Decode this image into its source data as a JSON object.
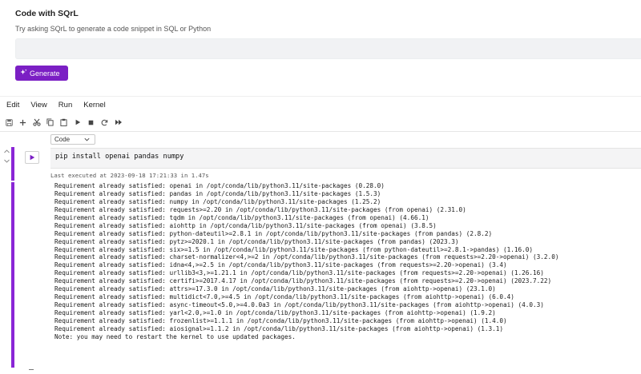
{
  "sqrl": {
    "title": "Code with SQrL",
    "hint": "Try asking SQrL to generate a code snippet in SQL or Python",
    "input_value": "",
    "generate_label": "Generate"
  },
  "menu": [
    "Edit",
    "View",
    "Run",
    "Kernel"
  ],
  "toolbar": [
    "save-icon",
    "add-icon",
    "cut-icon",
    "copy-icon",
    "paste-icon",
    "run-icon",
    "stop-icon",
    "restart-icon",
    "fast-forward-icon"
  ],
  "cell": {
    "type": "Code",
    "code": "pip install openai pandas numpy",
    "exec_meta": "Last executed at 2023-09-18 17:21:33 in 1.47s"
  },
  "output_lines": [
    "Requirement already satisfied: openai in /opt/conda/lib/python3.11/site-packages (0.28.0)",
    "Requirement already satisfied: pandas in /opt/conda/lib/python3.11/site-packages (1.5.3)",
    "Requirement already satisfied: numpy in /opt/conda/lib/python3.11/site-packages (1.25.2)",
    "Requirement already satisfied: requests>=2.20 in /opt/conda/lib/python3.11/site-packages (from openai) (2.31.0)",
    "Requirement already satisfied: tqdm in /opt/conda/lib/python3.11/site-packages (from openai) (4.66.1)",
    "Requirement already satisfied: aiohttp in /opt/conda/lib/python3.11/site-packages (from openai) (3.8.5)",
    "Requirement already satisfied: python-dateutil>=2.8.1 in /opt/conda/lib/python3.11/site-packages (from pandas) (2.8.2)",
    "Requirement already satisfied: pytz>=2020.1 in /opt/conda/lib/python3.11/site-packages (from pandas) (2023.3)",
    "Requirement already satisfied: six>=1.5 in /opt/conda/lib/python3.11/site-packages (from python-dateutil>=2.8.1->pandas) (1.16.0)",
    "Requirement already satisfied: charset-normalizer<4,>=2 in /opt/conda/lib/python3.11/site-packages (from requests>=2.20->openai) (3.2.0)",
    "Requirement already satisfied: idna<4,>=2.5 in /opt/conda/lib/python3.11/site-packages (from requests>=2.20->openai) (3.4)",
    "Requirement already satisfied: urllib3<3,>=1.21.1 in /opt/conda/lib/python3.11/site-packages (from requests>=2.20->openai) (1.26.16)",
    "Requirement already satisfied: certifi>=2017.4.17 in /opt/conda/lib/python3.11/site-packages (from requests>=2.20->openai) (2023.7.22)",
    "Requirement already satisfied: attrs>=17.3.0 in /opt/conda/lib/python3.11/site-packages (from aiohttp->openai) (23.1.0)",
    "Requirement already satisfied: multidict<7.0,>=4.5 in /opt/conda/lib/python3.11/site-packages (from aiohttp->openai) (6.0.4)",
    "Requirement already satisfied: async-timeout<5.0,>=4.0.0a3 in /opt/conda/lib/python3.11/site-packages (from aiohttp->openai) (4.0.3)",
    "Requirement already satisfied: yarl<2.0,>=1.0 in /opt/conda/lib/python3.11/site-packages (from aiohttp->openai) (1.9.2)",
    "Requirement already satisfied: frozenlist>=1.1.1 in /opt/conda/lib/python3.11/site-packages (from aiohttp->openai) (1.4.0)",
    "Requirement already satisfied: aiosignal>=1.1.2 in /opt/conda/lib/python3.11/site-packages (from aiohttp->openai) (1.3.1)",
    "Note: you may need to restart the kernel to use updated packages."
  ],
  "colors": {
    "accent": "#7b1fc4",
    "cell_bar": "#8a26d6"
  }
}
